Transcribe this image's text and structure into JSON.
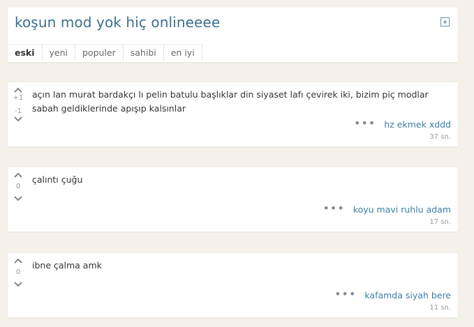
{
  "topic": {
    "title": "koşun mod yok hiç onlineeee",
    "tabs": [
      "eski",
      "yeni",
      "populer",
      "sahibi",
      "en iyi"
    ]
  },
  "entries": [
    {
      "up_count": "+1",
      "down_count": "-1",
      "text": "açın lan murat bardakçı lı pelin batulu başlıklar din siyaset lafı çevirek iki, bizim piç modlar sabah geldiklerinde apışıp kalsınlar",
      "author": "hz ekmek xddd",
      "time": "37 sn."
    },
    {
      "count": "0",
      "text": "çalıntı çuğu",
      "author": "koyu mavi ruhlu adam",
      "time": "17 sn."
    },
    {
      "count": "0",
      "text": "ibne çalma amk",
      "author": "kafamda siyah bere",
      "time": "11 sn."
    }
  ],
  "icons": {
    "expand": "+",
    "menu_dots": "•••"
  },
  "colors": {
    "title": "#3c6f8f",
    "author": "#3c7ea6",
    "background": "#f3f1ea"
  }
}
